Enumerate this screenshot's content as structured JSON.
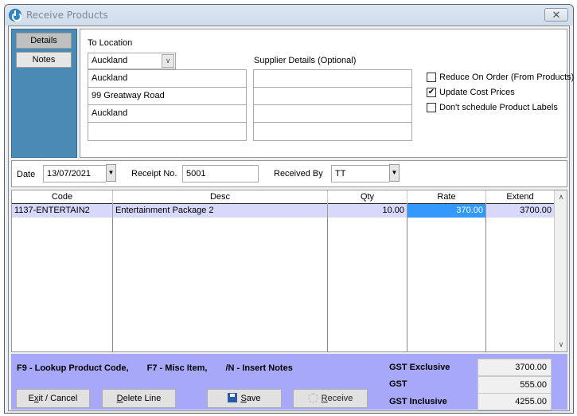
{
  "window": {
    "title": "Receive Products",
    "close_glyph": "✕"
  },
  "side_tabs": [
    {
      "label": "Details",
      "active": true
    },
    {
      "label": "Notes",
      "active": false
    }
  ],
  "to_location": {
    "label": "To Location",
    "selected": "Auckland",
    "address_lines": [
      "Auckland",
      "99 Greatway Road",
      "Auckland",
      ""
    ]
  },
  "supplier": {
    "label": "Supplier Details (Optional)",
    "lines": [
      "",
      "",
      "",
      ""
    ]
  },
  "options": [
    {
      "label": "Reduce On Order (From Products)",
      "checked": false
    },
    {
      "label": "Update Cost Prices",
      "checked": true
    },
    {
      "label": "Don't schedule Product Labels",
      "checked": false
    }
  ],
  "header_fields": {
    "date_label": "Date",
    "date_value": "13/07/2021",
    "receipt_label": "Receipt No.",
    "receipt_value": "5001",
    "received_by_label": "Received By",
    "received_by_value": "TT"
  },
  "grid": {
    "columns": [
      "Code",
      "Desc",
      "Qty",
      "Rate",
      "Extend"
    ],
    "rows": [
      {
        "code": "1137-ENTERTAIN2",
        "desc": "Entertainment Package 2",
        "qty": "10.00",
        "rate": "370.00",
        "extend": "3700.00"
      }
    ]
  },
  "hints": [
    "F9 - Lookup Product Code,",
    "F7 - Misc Item,",
    "/N - Insert Notes"
  ],
  "buttons": {
    "exit_pre": "E",
    "exit_u": "x",
    "exit_post": "it / Cancel",
    "delete_u": "D",
    "delete_post": "elete Line",
    "save_u": "S",
    "save_post": "ave",
    "receive_u": "R",
    "receive_post": "eceive"
  },
  "totals": {
    "gst_exclusive_label": "GST Exclusive",
    "gst_exclusive": "3700.00",
    "gst_label": "GST",
    "gst": "555.00",
    "gst_inclusive_label": "GST Inclusive",
    "gst_inclusive": "4255.00"
  }
}
